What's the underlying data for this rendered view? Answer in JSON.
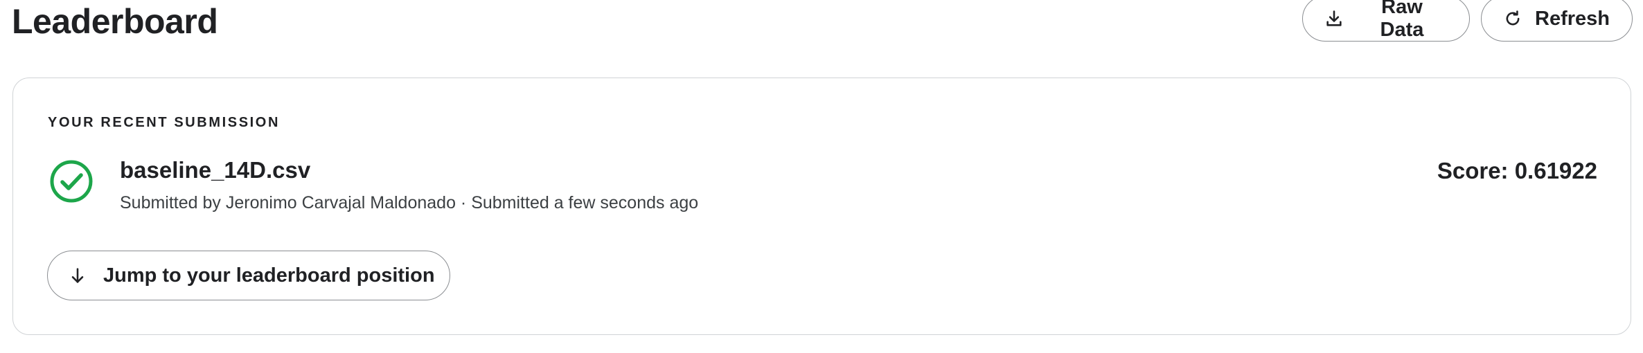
{
  "header": {
    "title": "Leaderboard",
    "raw_data_label": "Raw Data",
    "refresh_label": "Refresh"
  },
  "submission": {
    "heading": "YOUR RECENT SUBMISSION",
    "file_name": "baseline_14D.csv",
    "meta": "Submitted by Jeronimo Carvajal Maldonado · Submitted a few seconds ago",
    "score": "Score: 0.61922",
    "status_icon": "check-circle-icon",
    "jump_label": "Jump to your leaderboard position"
  },
  "colors": {
    "success": "#1da64a",
    "text": "#202124",
    "border": "#d0d3d6"
  }
}
